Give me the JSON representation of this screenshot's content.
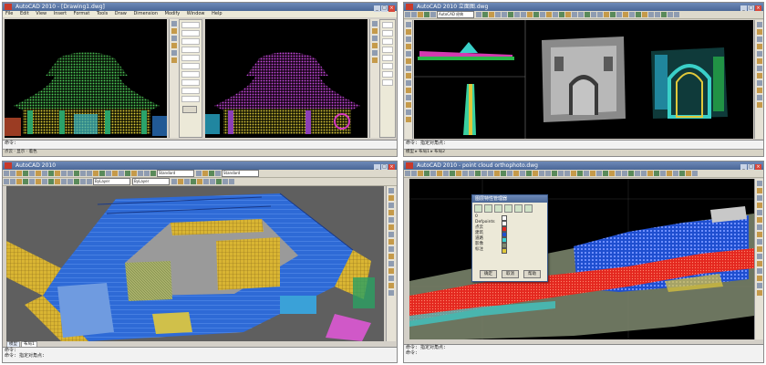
{
  "panels": {
    "top_left": {
      "title": "AutoCAD 2010 - [Drawing1.dwg]",
      "menu": [
        "File",
        "Edit",
        "View",
        "Insert",
        "Format",
        "Tools",
        "Draw",
        "Dimension",
        "Modify",
        "Window",
        "Help"
      ],
      "command_text": "命令:",
      "status_text": "点云 · 显示 · 着色"
    },
    "top_right": {
      "title": "AutoCAD 2010  立面图.dwg",
      "dropdown": "AutoCAD 经典",
      "command_text": "命令: 指定对角点:",
      "status_text": "模型 ▸ 布局1 ▸ 布局2"
    },
    "bottom_left": {
      "title": "AutoCAD 2010",
      "dropdown_1": "Standard",
      "dropdown_2": "ByLayer",
      "dropdown_3": "ByLayer",
      "dropdown_4": "Standard",
      "command_line_1": "命令:",
      "command_line_2": "命令: 指定对角点:",
      "status_tab_model": "模型",
      "status_tab_layout": "布局1"
    },
    "bottom_right": {
      "title": "AutoCAD 2010 - point cloud orthophoto.dwg",
      "command_line_1": "命令: 指定对角点:",
      "command_line_2": "命令:",
      "dialog": {
        "title": "图层特性管理器",
        "layers": [
          "0",
          "Defpoints",
          "点云",
          "建筑",
          "道路",
          "影像",
          "标注"
        ],
        "ok_label": "确定",
        "cancel_label": "取消",
        "help_label": "帮助"
      }
    }
  },
  "colors": {
    "ui_gray": "#d4d0c8",
    "titlebar": "#4a6796",
    "viewport_black": "#000000",
    "viewport_gray": "#5a5a5a",
    "pointcloud_blue": "#1f63d8",
    "pointcloud_red": "#e4281f",
    "pointcloud_yellow": "#e6c72a"
  },
  "icons": [
    "autocad-logo-icon",
    "minimize-icon",
    "maximize-icon",
    "close-icon",
    "layer-new-icon",
    "layer-delete-icon"
  ]
}
